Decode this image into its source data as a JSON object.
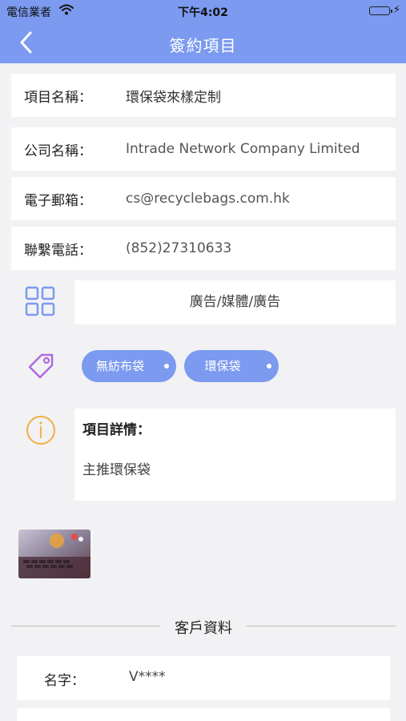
{
  "status_bar": {
    "carrier": "電信業者",
    "time": "下午4:02",
    "battery_level": 1.0,
    "battery_color": "#3ccd53"
  },
  "nav": {
    "title": "簽約項目",
    "back_icon": "chevron-left-icon",
    "color": "#7b9af0"
  },
  "fields": [
    {
      "label": "項目名稱：",
      "value": "環保袋來樣定制"
    },
    {
      "label": "公司名稱：",
      "value": "Intrade Network Company Limited"
    },
    {
      "label": "電子郵箱：",
      "value": "cs@recyclebags.com.hk"
    },
    {
      "label": "聯繫電話：",
      "value": "(852)27310633"
    }
  ],
  "category": {
    "icon": "grid-icon",
    "value": "廣告/媒體/廣告"
  },
  "tags": {
    "icon": "tag-icon",
    "items": [
      "無紡布袋",
      "環保袋"
    ]
  },
  "details": {
    "icon": "info-icon",
    "heading": "項目詳情：",
    "body": "主推環保袋"
  },
  "attachment": {
    "icon": "image-thumbnail"
  },
  "customer_section": {
    "title": "客戶資料",
    "fields": [
      {
        "label": "名字：",
        "value": "V****"
      }
    ]
  }
}
